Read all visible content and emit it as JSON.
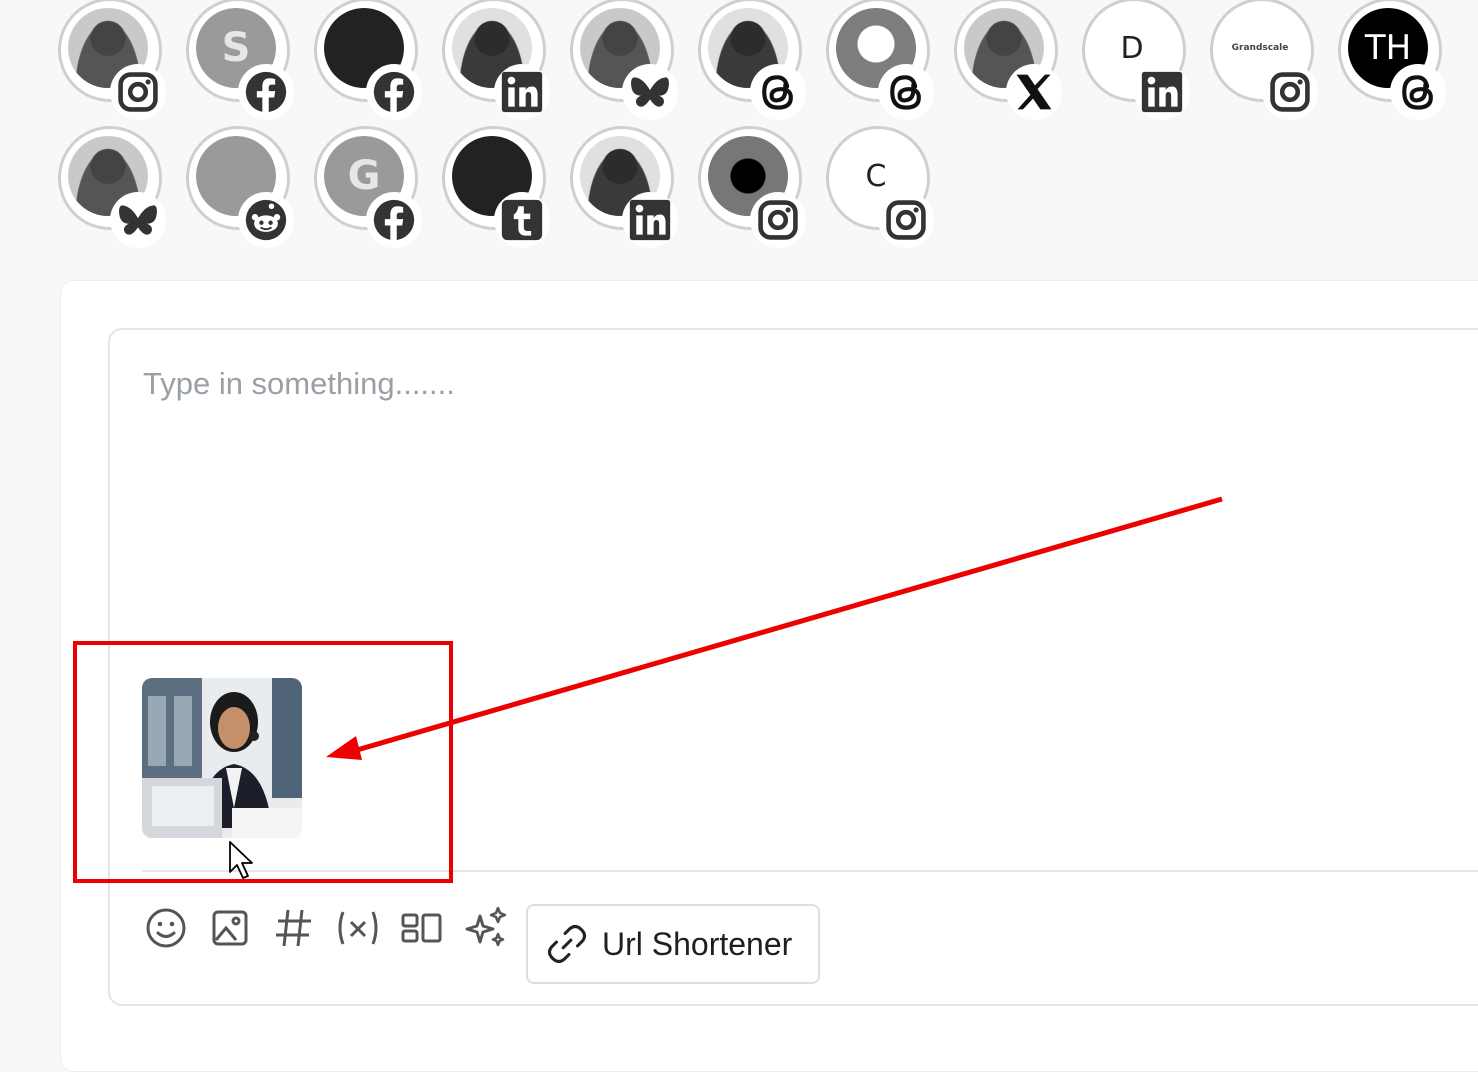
{
  "accounts_row1": [
    {
      "initial": "",
      "platform": "instagram",
      "style": "photo"
    },
    {
      "initial": "S",
      "platform": "facebook",
      "style": "gray"
    },
    {
      "initial": "",
      "platform": "facebook",
      "style": "dark"
    },
    {
      "initial": "",
      "platform": "linkedin",
      "style": "photo2"
    },
    {
      "initial": "",
      "platform": "bluesky",
      "style": "photo"
    },
    {
      "initial": "",
      "platform": "threads",
      "style": "photo2"
    },
    {
      "initial": "",
      "platform": "threads",
      "style": "ring"
    },
    {
      "initial": "",
      "platform": "x",
      "style": "photo"
    },
    {
      "initial": "D",
      "platform": "linkedin",
      "style": "light"
    },
    {
      "initial": "",
      "platform": "instagram",
      "style": "grandscale"
    },
    {
      "initial": "TH",
      "platform": "threads",
      "style": "black"
    }
  ],
  "accounts_row2": [
    {
      "initial": "",
      "platform": "bluesky",
      "style": "photo"
    },
    {
      "initial": "",
      "platform": "reddit",
      "style": "gray"
    },
    {
      "initial": "G",
      "platform": "facebook",
      "style": "gray"
    },
    {
      "initial": "",
      "platform": "tumblr",
      "style": "dark"
    },
    {
      "initial": "",
      "platform": "linkedin",
      "style": "photo2"
    },
    {
      "initial": "",
      "platform": "instagram",
      "style": "dot"
    },
    {
      "initial": "C",
      "platform": "instagram",
      "style": "light"
    }
  ],
  "grandscale_logo_text": "Grandscale",
  "editor": {
    "placeholder": "Type in something......."
  },
  "toolbar": {
    "icons": [
      "emoji-icon",
      "image-icon",
      "hashtag-icon",
      "variable-icon",
      "layout-icon",
      "sparkle-icon"
    ],
    "url_shortener_label": "Url Shortener"
  },
  "annotation_color": "#ee0000"
}
